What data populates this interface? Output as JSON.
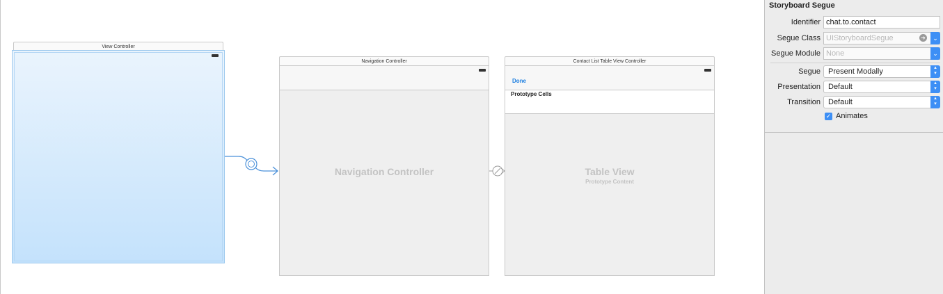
{
  "canvas": {
    "scenes": {
      "view_controller": {
        "title": "View Controller"
      },
      "navigation_controller": {
        "title": "Navigation Controller",
        "placeholder": "Navigation Controller"
      },
      "table_controller": {
        "title": "Contact List Table View Controller",
        "done_label": "Done",
        "prototype_cells_label": "Prototype Cells",
        "table_label": "Table View",
        "table_sublabel": "Prototype Content"
      }
    }
  },
  "inspector": {
    "header": "Storyboard Segue",
    "identifier": {
      "label": "Identifier",
      "value": "chat.to.contact"
    },
    "segue_class": {
      "label": "Segue Class",
      "placeholder": "UIStoryboardSegue"
    },
    "segue_module": {
      "label": "Segue Module",
      "placeholder": "None"
    },
    "segue": {
      "label": "Segue",
      "value": "Present Modally"
    },
    "presentation": {
      "label": "Presentation",
      "value": "Default"
    },
    "transition": {
      "label": "Transition",
      "value": "Default"
    },
    "animates": {
      "label": "Animates",
      "checked": true
    },
    "colors": {
      "accent": "#3d8ff5",
      "segue_line": "#4a90d9"
    }
  }
}
